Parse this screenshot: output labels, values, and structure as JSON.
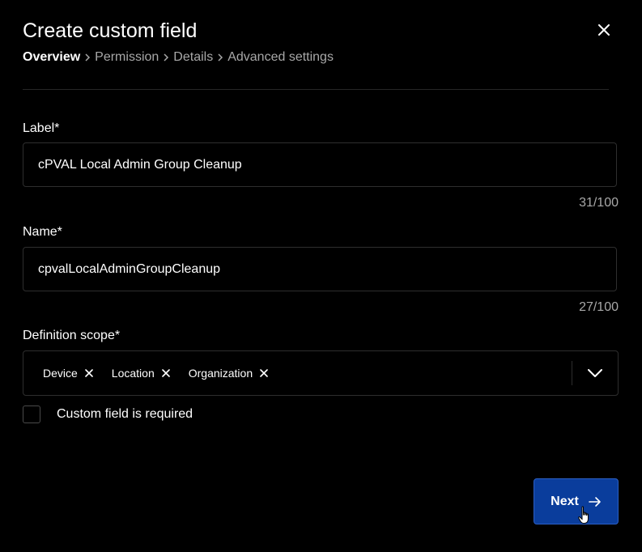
{
  "modal": {
    "title": "Create custom field",
    "close_icon": "close-icon"
  },
  "breadcrumb": {
    "items": [
      "Overview",
      "Permission",
      "Details",
      "Advanced settings"
    ],
    "separator_icon": "chevron-right-icon",
    "active_index": 0
  },
  "fields": {
    "label": {
      "label": "Label*",
      "value": "cPVAL Local Admin Group Cleanup",
      "counter": "31/100"
    },
    "name": {
      "label": "Name*",
      "value": "cpvalLocalAdminGroupCleanup",
      "counter": "27/100"
    },
    "scope": {
      "label": "Definition scope*",
      "chips": [
        "Device",
        "Location",
        "Organization"
      ],
      "chip_remove_icon": "close-icon",
      "dropdown_icon": "chevron-down-icon"
    }
  },
  "required_checkbox": {
    "label": "Custom field is required",
    "checked": false
  },
  "footer": {
    "next_label": "Next",
    "next_icon": "arrow-right-icon"
  },
  "colors": {
    "background": "#000000",
    "border": "#2e2e2e",
    "muted_text": "#a8a8a8",
    "primary_button": "#0a3d9c"
  }
}
